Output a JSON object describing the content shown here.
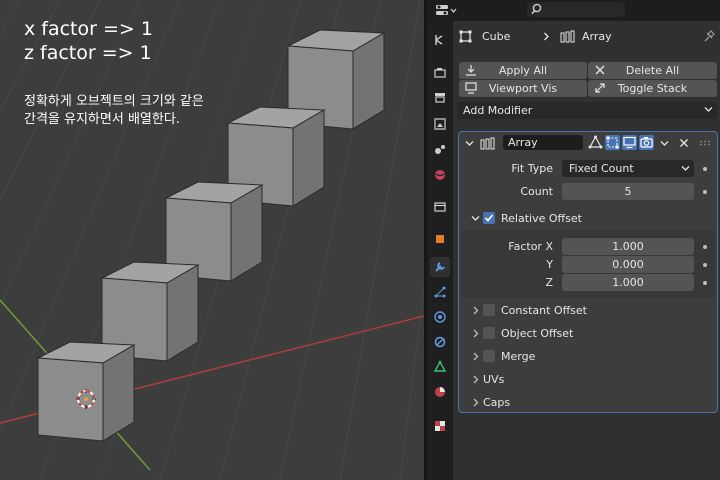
{
  "annotation": {
    "line1": "x factor => 1",
    "line2": "z factor => 1",
    "korean_line1": "정확하게 오브젝트의 크기와 같은",
    "korean_line2": "간격을 유지하면서 배열한다."
  },
  "header": {
    "editor_type_icon": "properties-editor-icon",
    "search_icon": "search-icon"
  },
  "tabs": [
    {
      "name": "tool",
      "icon": "tool-icon"
    },
    {
      "name": "render",
      "icon": "render-icon"
    },
    {
      "name": "output",
      "icon": "output-icon"
    },
    {
      "name": "view-layer",
      "icon": "view-layer-icon"
    },
    {
      "name": "scene",
      "icon": "scene-icon"
    },
    {
      "name": "world",
      "icon": "world-icon"
    },
    {
      "name": "collection",
      "icon": "collection-icon"
    },
    {
      "name": "object",
      "icon": "object-icon"
    },
    {
      "name": "modifiers",
      "icon": "wrench-icon",
      "active": true
    },
    {
      "name": "particles",
      "icon": "particles-icon"
    },
    {
      "name": "physics",
      "icon": "physics-icon"
    },
    {
      "name": "constraints",
      "icon": "constraints-icon"
    },
    {
      "name": "data",
      "icon": "mesh-data-icon"
    },
    {
      "name": "material",
      "icon": "material-icon"
    },
    {
      "name": "texture",
      "icon": "texture-icon"
    }
  ],
  "breadcrumb": {
    "object": "Cube",
    "modifier": "Array"
  },
  "toolbar": {
    "apply_all": "Apply All",
    "delete_all": "Delete All",
    "viewport_vis": "Viewport Vis",
    "toggle_stack": "Toggle Stack",
    "add_modifier": "Add Modifier"
  },
  "modifier": {
    "name": "Array",
    "fit_type_label": "Fit Type",
    "fit_type_value": "Fixed Count",
    "count_label": "Count",
    "count_value": "5",
    "relative_offset": {
      "label": "Relative Offset",
      "enabled": true,
      "factor_x_label": "Factor X",
      "factor_x": "1.000",
      "y_label": "Y",
      "factor_y": "0.000",
      "z_label": "Z",
      "factor_z": "1.000"
    },
    "subpanels": [
      {
        "label": "Constant Offset",
        "checkbox": true,
        "checked": false
      },
      {
        "label": "Object Offset",
        "checkbox": true,
        "checked": false
      },
      {
        "label": "Merge",
        "checkbox": true,
        "checked": false
      },
      {
        "label": "UVs",
        "checkbox": false
      },
      {
        "label": "Caps",
        "checkbox": false
      }
    ]
  },
  "colors": {
    "accent": "#4772b3",
    "viewport_bg": "#3d3d3d",
    "cube_top": "#a3a3a3",
    "cube_front": "#8c8c8c",
    "cube_side": "#737373",
    "x_axis": "#b23c3c",
    "y_axis": "#6e9b33"
  }
}
